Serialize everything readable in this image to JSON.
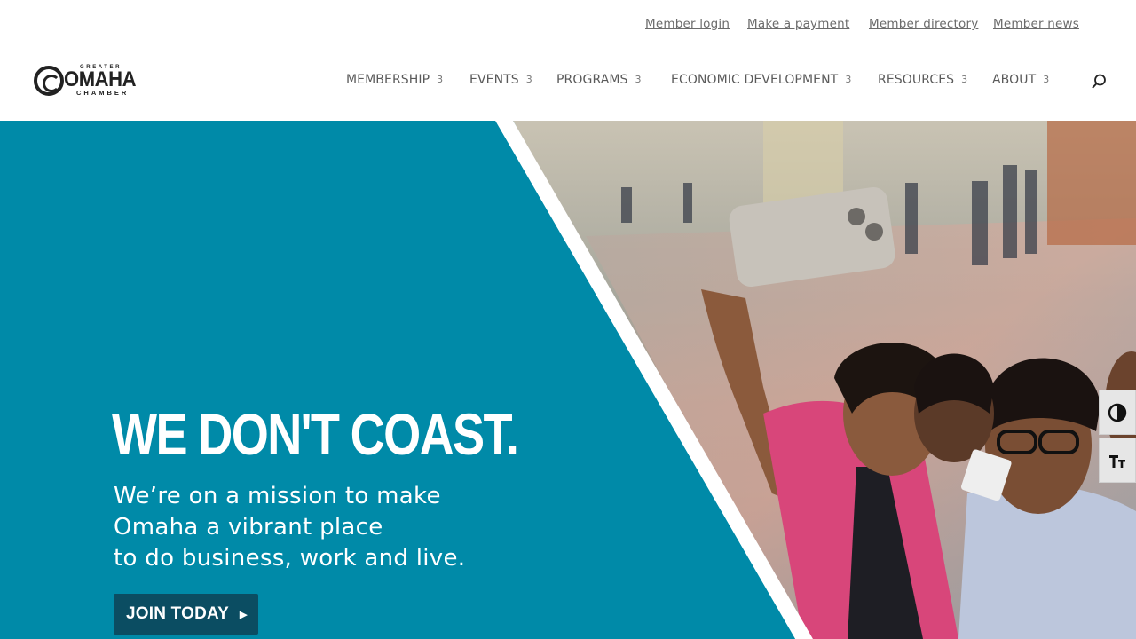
{
  "utility_links": [
    "Member login",
    "Make a payment",
    "Member directory",
    "Member news"
  ],
  "logo": {
    "greater": "GREATER",
    "omaha": "OMAHA",
    "chamber": "CHAMBER"
  },
  "nav": [
    {
      "label": "MEMBERSHIP",
      "chevron": "3"
    },
    {
      "label": "EVENTS",
      "chevron": "3"
    },
    {
      "label": "PROGRAMS",
      "chevron": "3"
    },
    {
      "label": "ECONOMIC DEVELOPMENT",
      "chevron": "3"
    },
    {
      "label": "RESOURCES",
      "chevron": "3"
    },
    {
      "label": "ABOUT",
      "chevron": "3"
    }
  ],
  "hero": {
    "headline": "WE DON'T COAST.",
    "sub_lines": [
      "We’re on a mission to make",
      "Omaha a vibrant place",
      "to do business, work and live."
    ],
    "cta": "JOIN TODAY",
    "cta_arrow": "▶"
  },
  "icons": {
    "search": "search-icon",
    "contrast": "contrast-toggle-icon",
    "text_size": "text-size-icon"
  },
  "colors": {
    "hero_teal": "#008aa8",
    "cta_bg": "#0b4d62",
    "nav_text": "#5a5a5a"
  }
}
